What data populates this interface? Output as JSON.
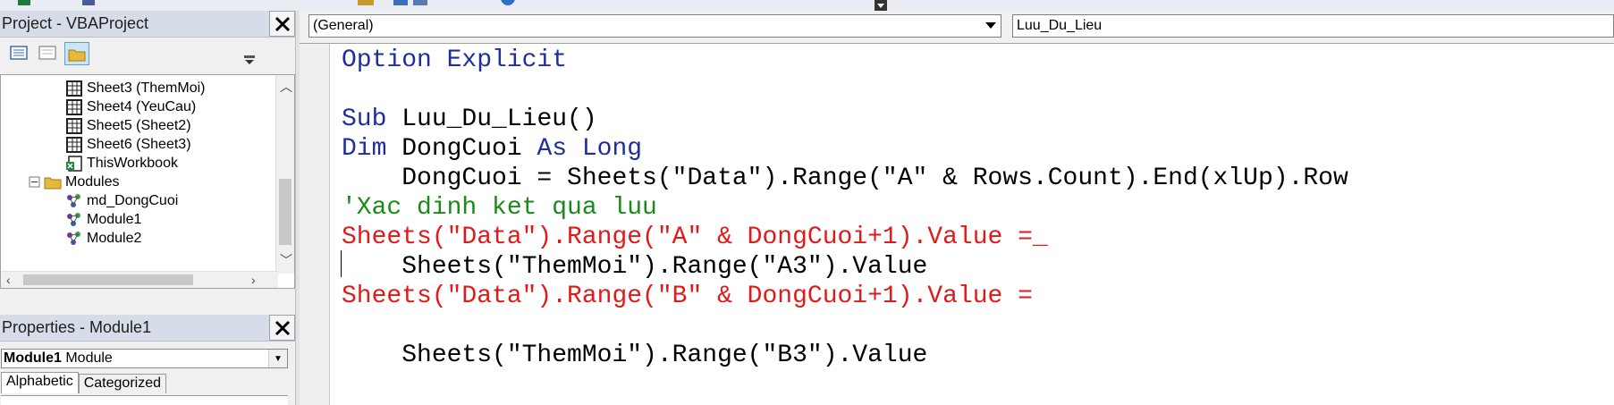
{
  "project_panel": {
    "title": "Project - VBAProject",
    "tree": [
      {
        "label": "Sheet3 (ThemMoi)",
        "icon": "worksheet-icon"
      },
      {
        "label": "Sheet4 (YeuCau)",
        "icon": "worksheet-icon"
      },
      {
        "label": "Sheet5 (Sheet2)",
        "icon": "worksheet-icon"
      },
      {
        "label": "Sheet6 (Sheet3)",
        "icon": "worksheet-icon"
      },
      {
        "label": "ThisWorkbook",
        "icon": "workbook-icon"
      },
      {
        "label": "Modules",
        "icon": "folder-icon",
        "expander": "⊟"
      },
      {
        "label": "md_DongCuoi",
        "icon": "module-icon"
      },
      {
        "label": "Module1",
        "icon": "module-icon"
      },
      {
        "label": "Module2",
        "icon": "module-icon"
      }
    ]
  },
  "properties_panel": {
    "title": "Properties - Module1",
    "object_name": "Module1",
    "object_type": "Module",
    "tabs": [
      "Alphabetic",
      "Categorized"
    ]
  },
  "code_window": {
    "object_combo": "(General)",
    "procedure_combo": "Luu_Du_Lieu",
    "lines": [
      {
        "n": 0,
        "segs": [
          {
            "t": "Option Explicit",
            "c": "kw"
          }
        ]
      },
      {
        "n": 2,
        "segs": [
          {
            "t": "Sub",
            "c": "kw"
          },
          {
            "t": " Luu_Du_Lieu()",
            "c": ""
          }
        ]
      },
      {
        "n": 3,
        "segs": [
          {
            "t": "Dim",
            "c": "kw"
          },
          {
            "t": " DongCuoi ",
            "c": ""
          },
          {
            "t": "As Long",
            "c": "kw"
          }
        ]
      },
      {
        "n": 4,
        "segs": [
          {
            "t": "    DongCuoi = Sheets(\"Data\").Range(\"A\" & Rows.Count).End(xlUp).Row",
            "c": ""
          }
        ]
      },
      {
        "n": 5,
        "segs": [
          {
            "t": "'Xac dinh ket qua luu",
            "c": "cm"
          }
        ]
      },
      {
        "n": 6,
        "segs": [
          {
            "t": "Sheets(\"Data\").Range(\"A\" & DongCuoi+1).Value =_",
            "c": "er"
          }
        ]
      },
      {
        "n": 7,
        "segs": [
          {
            "t": "    Sheets(\"ThemMoi\").Range(\"A3\").Value",
            "c": ""
          }
        ]
      },
      {
        "n": 8,
        "segs": [
          {
            "t": "Sheets(\"Data\").Range(\"B\" & DongCuoi+1).Value =",
            "c": "er"
          }
        ]
      },
      {
        "n": 10,
        "segs": [
          {
            "t": "    Sheets(\"ThemMoi\").Range(\"B3\").Value",
            "c": ""
          }
        ]
      }
    ]
  },
  "colors": {
    "keyword": "#1f2e9a",
    "comment": "#1a8a1a",
    "error": "#e01a1a",
    "panel_title_bg": "#d6dde8"
  }
}
